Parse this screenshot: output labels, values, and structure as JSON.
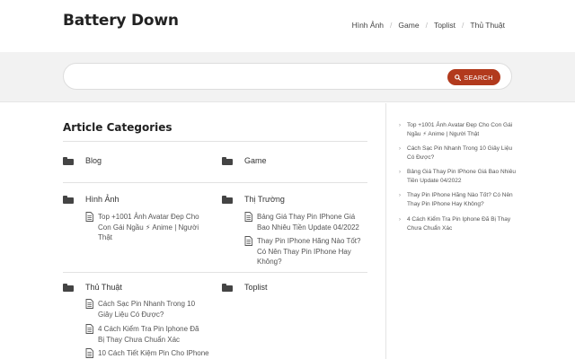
{
  "site": {
    "title": "Battery Down"
  },
  "nav": {
    "items": [
      "Hình Ảnh",
      "Game",
      "Toplist",
      "Thủ Thuật"
    ],
    "separator": "/"
  },
  "search": {
    "placeholder": "",
    "button_label": "SEARCH"
  },
  "categories_section": {
    "title": "Article Categories",
    "categories": [
      {
        "name": "Blog",
        "articles": []
      },
      {
        "name": "Game",
        "articles": []
      },
      {
        "name": "Hình Ảnh",
        "articles": [
          "Top +1001 Ảnh Avatar Đẹp Cho Con Gái Ngầu ⚡ Anime | Người Thật"
        ]
      },
      {
        "name": "Thị Trường",
        "articles": [
          "Bảng Giá Thay Pin IPhone Giá Bao Nhiêu Tiền Update 04/2022",
          "Thay Pin IPhone Hãng Nào Tốt? Có Nên Thay Pin IPhone Hay Không?"
        ]
      },
      {
        "name": "Thủ Thuật",
        "articles": [
          "Cách Sạc Pin Nhanh Trong 10 Giây Liệu Có Được?",
          "4 Cách Kiểm Tra Pin Iphone Đã Bị Thay Chưa Chuẩn Xác",
          "10 Cách Tiết Kiệm Pin Cho IPhone"
        ]
      },
      {
        "name": "Toplist",
        "articles": []
      }
    ]
  },
  "sidebar": {
    "bullet": "›",
    "items": [
      "Top +1001 Ảnh Avatar Đẹp Cho Con Gái Ngầu ⚡ Anime | Người Thật",
      "Cách Sạc Pin Nhanh Trong 10 Giây Liệu Có Được?",
      "Bảng Giá Thay Pin IPhone Giá Bao Nhiêu Tiền Update 04/2022",
      "Thay Pin IPhone Hãng Nào Tốt? Có Nên Thay Pin IPhone Hay Không?",
      "4 Cách Kiểm Tra Pin Iphone Đã Bị Thay Chưa Chuẩn Xác"
    ]
  },
  "colors": {
    "accent": "#b23a1d",
    "search_band": "#f2f2f2",
    "text": "#333333"
  },
  "icons": {
    "category": "folder-icon",
    "article": "document-icon",
    "search": "search-icon"
  }
}
